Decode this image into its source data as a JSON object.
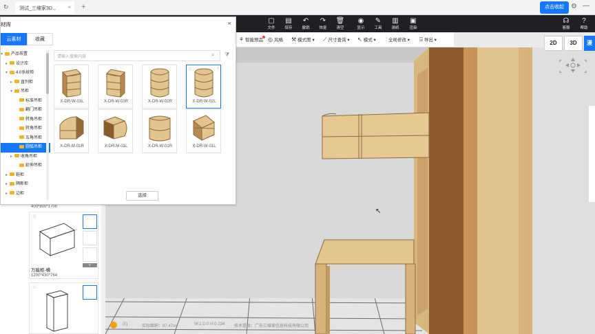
{
  "browser": {
    "tab_title": "测试_三维家3D...",
    "close_glyph": "×",
    "refresh_glyph": "↻",
    "new_tab_glyph": "+",
    "buy_label": "点击收起",
    "minimize_glyph": "—",
    "gear_glyph": "⚙"
  },
  "top_toolbar": {
    "items": [
      {
        "label": "文件",
        "icon": "file-icon",
        "glyph": "▢"
      },
      {
        "label": "保存",
        "icon": "save-icon",
        "glyph": "▤"
      },
      {
        "label": "撤销",
        "icon": "undo-icon",
        "glyph": "↶"
      },
      {
        "label": "恢复",
        "icon": "redo-icon",
        "glyph": "↷"
      },
      {
        "label": "清空",
        "icon": "clear-icon",
        "glyph": "🗑"
      },
      {
        "label": "显示",
        "icon": "eye-icon",
        "glyph": "◉"
      },
      {
        "label": "工具",
        "icon": "tool-icon",
        "glyph": "✎"
      },
      {
        "label": "测纸",
        "icon": "map-icon",
        "glyph": "▥"
      },
      {
        "label": "渲染",
        "icon": "render-icon",
        "glyph": "▣"
      }
    ],
    "right_items": [
      {
        "label": "客服",
        "icon": "service-icon",
        "glyph": "☊"
      },
      {
        "label": "帮助",
        "icon": "help-icon",
        "glyph": "?"
      }
    ]
  },
  "secondary_toolbar": {
    "items": [
      {
        "label": "智能预品",
        "icon": "smart-icon",
        "glyph": "⚘"
      },
      {
        "label": "风格",
        "icon": "style-icon",
        "glyph": "◎"
      },
      {
        "label": "模式图",
        "icon": "hammer-icon",
        "glyph": "⚒"
      },
      {
        "label": "尺寸查询",
        "icon": "ruler-icon",
        "glyph": "⟋"
      },
      {
        "label": "模式",
        "icon": "pointer-icon",
        "glyph": "↖"
      },
      {
        "label": "全局修改",
        "icon": "bars-icon",
        "glyph": "⫶"
      },
      {
        "label": "导出",
        "icon": "export-icon",
        "glyph": "⍈"
      }
    ]
  },
  "view_buttons": [
    "2D",
    "3D",
    "漫游"
  ],
  "library": {
    "title": "材库",
    "close_glyph": "×",
    "tabs": [
      "云素材",
      "收藏"
    ],
    "tree": [
      {
        "label": "产品布置",
        "level": 0,
        "caret": "▾",
        "selected": false
      },
      {
        "label": "设计库",
        "level": 1,
        "caret": "▸",
        "selected": false
      },
      {
        "label": "4.0系统柜",
        "level": 1,
        "caret": "▾",
        "selected": false
      },
      {
        "label": "直列柜",
        "level": 2,
        "caret": "▸",
        "selected": false
      },
      {
        "label": "吊柜",
        "level": 2,
        "caret": "▾",
        "selected": false
      },
      {
        "label": "标准吊柜",
        "level": 3,
        "caret": "",
        "selected": false
      },
      {
        "label": "翻门吊柜",
        "level": 3,
        "caret": "",
        "selected": false
      },
      {
        "label": "转角吊柜",
        "level": 3,
        "caret": "",
        "selected": false
      },
      {
        "label": "转角吊柜",
        "level": 3,
        "caret": "",
        "selected": false
      },
      {
        "label": "五角吊柜",
        "level": 3,
        "caret": "",
        "selected": false
      },
      {
        "label": "圆弧吊柜",
        "level": 3,
        "caret": "",
        "selected": true
      },
      {
        "label": "收角吊柜",
        "level": 2,
        "caret": "▸",
        "selected": false
      },
      {
        "label": "延伸吊柜",
        "level": 3,
        "caret": "",
        "selected": false
      },
      {
        "label": "鞋柜",
        "level": 1,
        "caret": "▸",
        "selected": false
      },
      {
        "label": "隔断柜",
        "level": 1,
        "caret": "▸",
        "selected": false
      },
      {
        "label": "边柜",
        "level": 1,
        "caret": "▸",
        "selected": false
      }
    ],
    "search_placeholder": "请输入搜索内容",
    "search_glyph": "⌕",
    "filter_glyph": "⧩",
    "items": [
      {
        "label": "X-DR-W-03L",
        "shape": "tower-left",
        "selected": false
      },
      {
        "label": "X-DR-W-03R",
        "shape": "tower-right",
        "selected": false
      },
      {
        "label": "X-DR-W-02R",
        "shape": "tower-round",
        "selected": false
      },
      {
        "label": "X-DR-W-02L",
        "shape": "tower-round",
        "selected": true
      },
      {
        "label": "X-DR-M-01R",
        "shape": "box-round",
        "selected": false
      },
      {
        "label": "X-DR-M-01L",
        "shape": "box-dark",
        "selected": false
      },
      {
        "label": "X-DR-W-01R",
        "shape": "open-round",
        "selected": false
      },
      {
        "label": "X-DR-W-01L",
        "shape": "open-corner",
        "selected": false
      }
    ],
    "star_glyph": "☆",
    "download_glyph": "↓",
    "select_label": "选择"
  },
  "lower_panel": {
    "top_size": "400*800*1700",
    "items": [
      {
        "name": "万能柜-横",
        "size": "1200*430*764"
      },
      {
        "name": "",
        "size": ""
      }
    ],
    "star_glyph": "☆"
  },
  "status_bar": {
    "badge_glyph": "♪",
    "count": "(0)",
    "area": "实际面积：97.47m²",
    "coords": "W:1 D:0 H:0 234",
    "support": "技术提供：广东三维家信息科技有限公司"
  },
  "colors": {
    "accent": "#1677ff",
    "dark_bar": "#1f2024",
    "wood": "#e2c48f",
    "wood_dark": "#9a6a3a"
  }
}
